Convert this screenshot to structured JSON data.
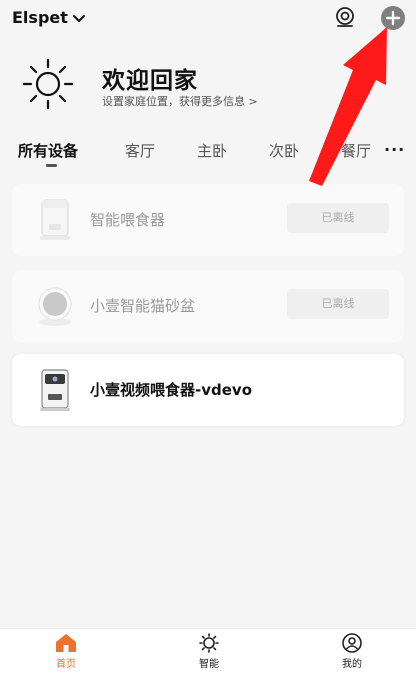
{
  "header": {
    "home_name": "Elspet",
    "scan_icon": "camera-scan-icon",
    "add_icon": "plus-circle-icon"
  },
  "welcome": {
    "icon": "sun-icon",
    "title": "欢迎回家",
    "subtitle": "设置家庭位置，获得更多信息 >"
  },
  "tabs": [
    {
      "label": "所有设备",
      "active": true
    },
    {
      "label": "客厅"
    },
    {
      "label": "主卧"
    },
    {
      "label": "次卧"
    },
    {
      "label": "餐厅"
    }
  ],
  "tabs_more": "···",
  "devices": [
    {
      "name": "智能喂食器",
      "status": "已离线",
      "online": false
    },
    {
      "name": "小壹智能猫砂盆",
      "status": "已离线",
      "online": false
    },
    {
      "name": "小壹视频喂食器-vdevo",
      "status": "",
      "online": true
    }
  ],
  "bottom_nav": [
    {
      "label": "首页",
      "icon": "home-icon",
      "active": true
    },
    {
      "label": "智能",
      "icon": "sun-smart-icon"
    },
    {
      "label": "我的",
      "icon": "profile-icon"
    }
  ],
  "colors": {
    "accent": "#f07030",
    "annotation_arrow": "#ff1a1a"
  }
}
